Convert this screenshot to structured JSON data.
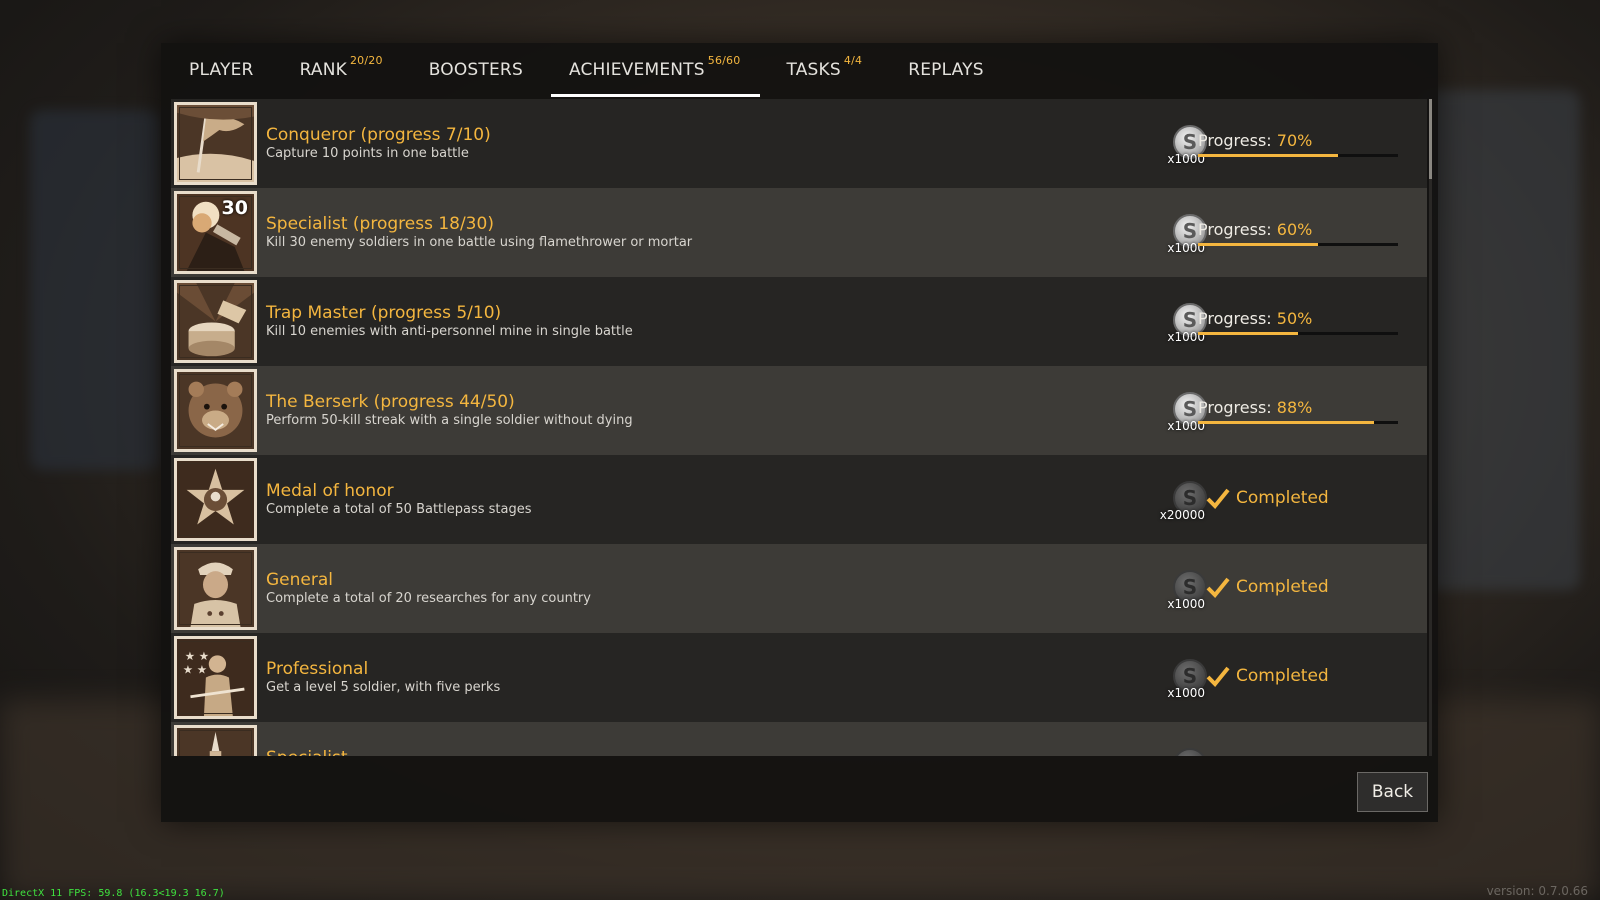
{
  "tabs": [
    {
      "label": "PLAYER",
      "sup": ""
    },
    {
      "label": "RANK",
      "sup": "20/20"
    },
    {
      "label": "BOOSTERS",
      "sup": ""
    },
    {
      "label": "ACHIEVEMENTS",
      "sup": "56/60"
    },
    {
      "label": "TASKS",
      "sup": "4/4"
    },
    {
      "label": "REPLAYS",
      "sup": ""
    }
  ],
  "active_tab": "ACHIEVEMENTS",
  "achievements": [
    {
      "title": "Conqueror (progress 7/10)",
      "desc": "Capture 10 points in one battle",
      "reward": "x1000",
      "progress_label": "Progress:",
      "progress_pct": "70%",
      "progress": 0.7,
      "badge": "flag-icon"
    },
    {
      "title": "Specialist (progress 18/30)",
      "desc": "Kill 30 enemy soldiers in one battle using flamethrower or mortar",
      "reward": "x1000",
      "progress_label": "Progress:",
      "progress_pct": "60%",
      "progress": 0.6,
      "badge_num": "30",
      "badge": "flamethrower-icon"
    },
    {
      "title": "Trap Master (progress 5/10)",
      "desc": "Kill 10 enemies with anti-personnel mine in single battle",
      "reward": "x1000",
      "progress_label": "Progress:",
      "progress_pct": "50%",
      "progress": 0.5,
      "badge": "mine-icon"
    },
    {
      "title": "The Berserk (progress 44/50)",
      "desc": "Perform 50-kill streak with a single soldier without dying",
      "reward": "x1000",
      "progress_label": "Progress:",
      "progress_pct": "88%",
      "progress": 0.88,
      "badge": "bear-icon"
    },
    {
      "title": "Medal of honor",
      "desc": "Complete a total of 50 Battlepass stages",
      "reward": "x20000",
      "status": "Completed",
      "badge": "medal-icon"
    },
    {
      "title": "General",
      "desc": "Complete a total of 20 researches for any country",
      "reward": "x1000",
      "status": "Completed",
      "badge": "general-icon"
    },
    {
      "title": "Professional",
      "desc": "Get a level 5 soldier, with five perks",
      "reward": "x1000",
      "status": "Completed",
      "badge": "soldier-icon"
    },
    {
      "title": "Specialist",
      "desc": "",
      "reward": "",
      "badge": "statue-icon"
    }
  ],
  "back_label": "Back",
  "fps_text": "DirectX 11 FPS: 59.8 (16.3<19.3 16.7)",
  "version_text": "version: 0.7.0.66",
  "colors": {
    "accent": "#f4b63f",
    "row_dark": "#282624",
    "row_light": "#403d39"
  }
}
